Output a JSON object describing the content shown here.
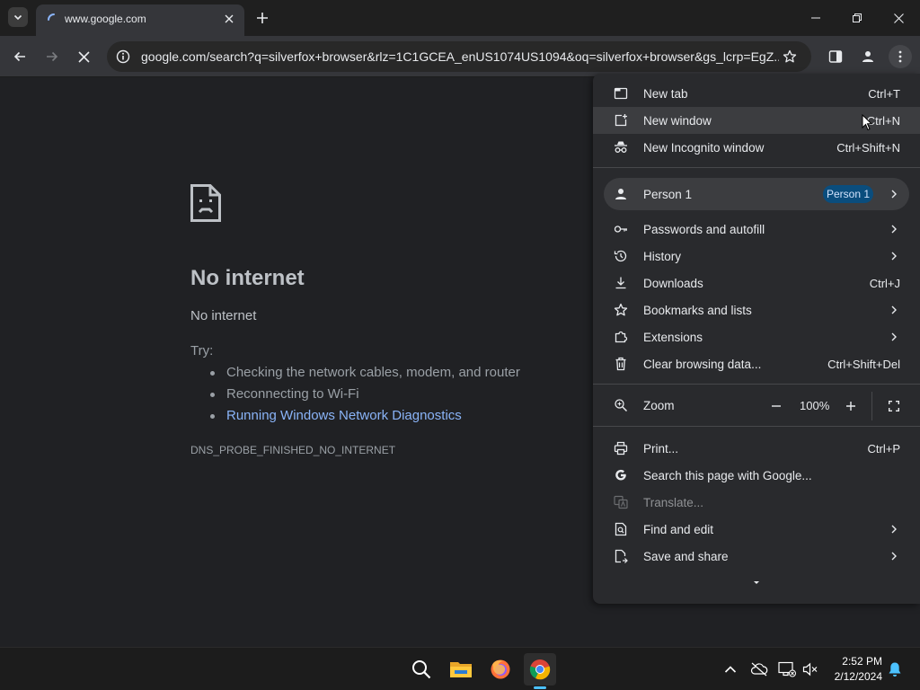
{
  "browser": {
    "tab": {
      "title": "www.google.com"
    },
    "address_bar": {
      "url": "google.com/search?q=silverfox+browser&rlz=1C1GCEA_enUS1074US1094&oq=silverfox+browser&gs_lcrp=EgZ..."
    }
  },
  "error_page": {
    "title": "No internet",
    "subtitle": "No internet",
    "try_label": "Try:",
    "suggestions": [
      "Checking the network cables, modem, and router",
      "Reconnecting to Wi-Fi",
      "Running Windows Network Diagnostics"
    ],
    "error_code": "DNS_PROBE_FINISHED_NO_INTERNET"
  },
  "menu": {
    "new_tab": {
      "label": "New tab",
      "shortcut": "Ctrl+T"
    },
    "new_window": {
      "label": "New window",
      "shortcut": "Ctrl+N"
    },
    "new_incognito": {
      "label": "New Incognito window",
      "shortcut": "Ctrl+Shift+N"
    },
    "person": {
      "label": "Person 1",
      "badge": "Person 1"
    },
    "passwords": {
      "label": "Passwords and autofill"
    },
    "history": {
      "label": "History"
    },
    "downloads": {
      "label": "Downloads",
      "shortcut": "Ctrl+J"
    },
    "bookmarks": {
      "label": "Bookmarks and lists"
    },
    "extensions": {
      "label": "Extensions"
    },
    "clear_data": {
      "label": "Clear browsing data...",
      "shortcut": "Ctrl+Shift+Del"
    },
    "zoom": {
      "label": "Zoom",
      "level": "100%"
    },
    "print": {
      "label": "Print...",
      "shortcut": "Ctrl+P"
    },
    "search_page": {
      "label": "Search this page with Google..."
    },
    "translate": {
      "label": "Translate..."
    },
    "find_edit": {
      "label": "Find and edit"
    },
    "save_share": {
      "label": "Save and share"
    }
  },
  "taskbar": {
    "clock": {
      "time": "2:52 PM",
      "date": "2/12/2024"
    }
  },
  "colors": {
    "accent": "#8ab4f8",
    "badge": "#0a4d7d",
    "taskbar_indicator": "#4cc2ff"
  }
}
